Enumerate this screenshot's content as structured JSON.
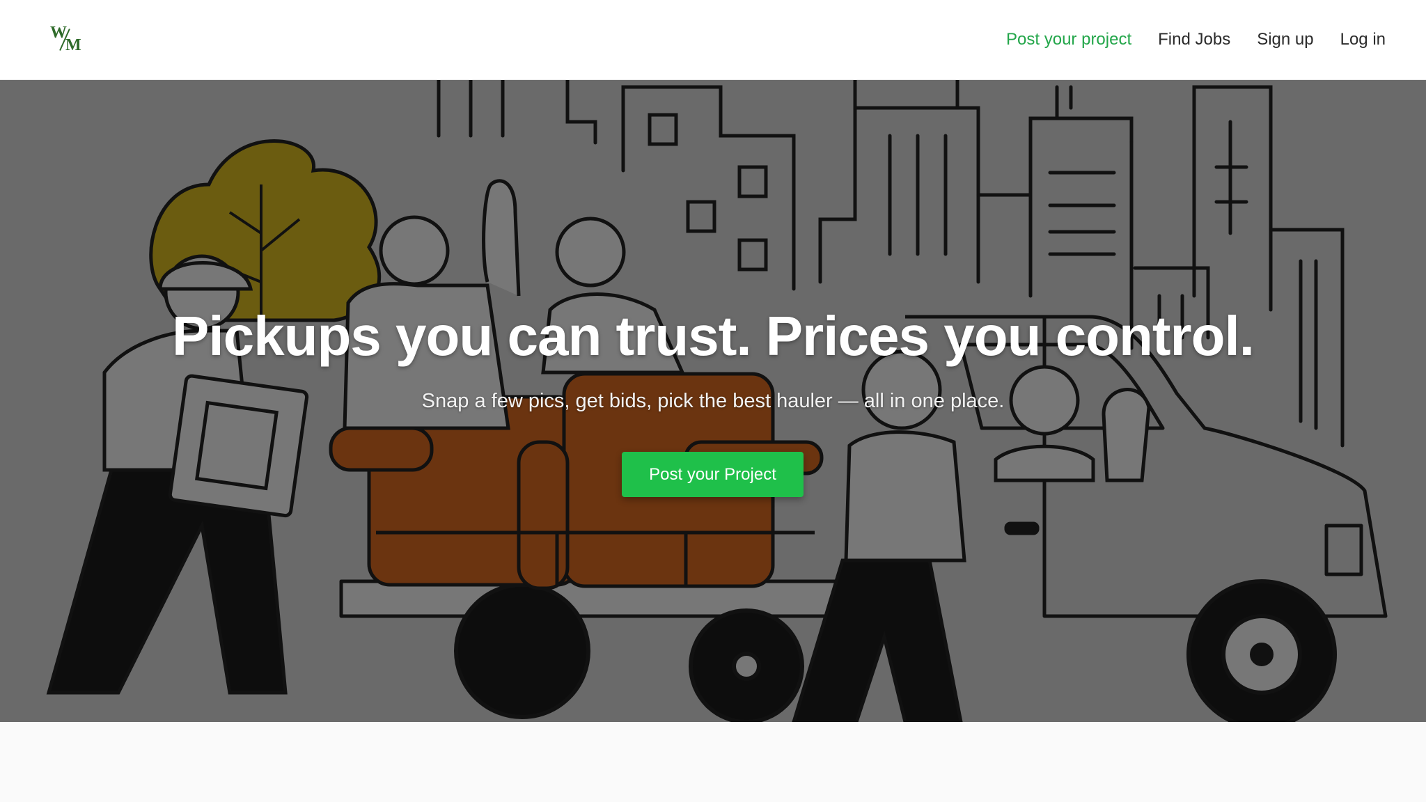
{
  "brand": {
    "logo_letters": [
      "W",
      "M"
    ],
    "accent_color": "#23a64a",
    "logo_color": "#2f6b2a"
  },
  "nav": {
    "items": [
      {
        "label": "Post your project",
        "active": true
      },
      {
        "label": "Find Jobs"
      },
      {
        "label": "Sign up"
      },
      {
        "label": "Log in"
      }
    ]
  },
  "hero": {
    "title": "Pickups you can trust. Prices you control.",
    "subtitle": "Snap a few pics, get bids, pick the best hauler — all in one place.",
    "cta_label": "Post your Project",
    "cta_color": "#1fc04a",
    "illustration": "movers-loading-truck-city-skyline"
  }
}
